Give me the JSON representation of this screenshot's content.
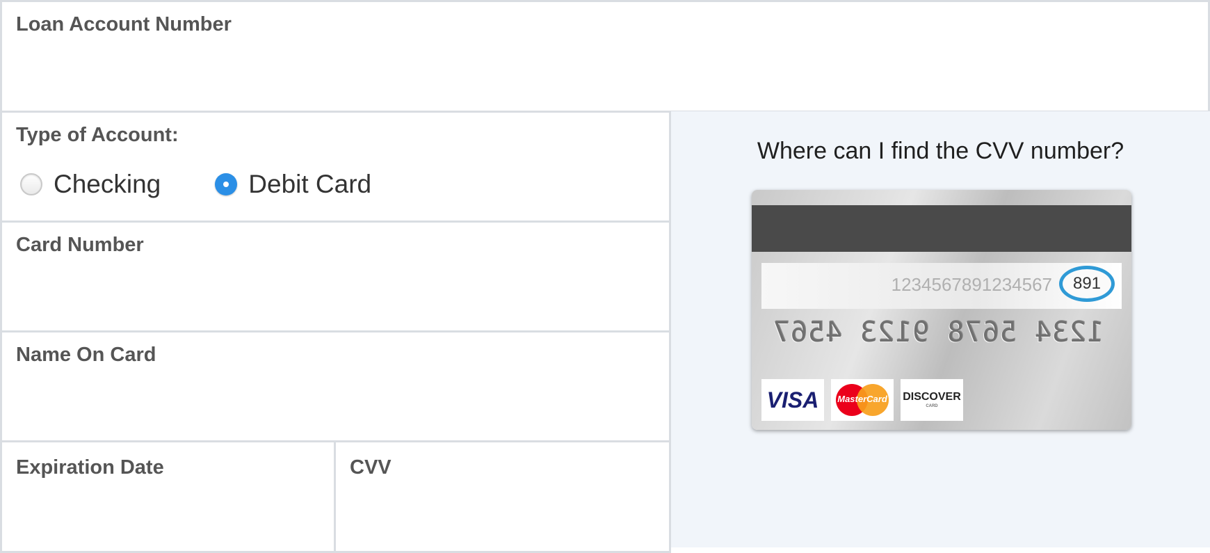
{
  "form": {
    "loan_account": {
      "label": "Loan Account Number",
      "value": ""
    },
    "account_type": {
      "label": "Type of Account:",
      "options": [
        {
          "label": "Checking",
          "selected": false
        },
        {
          "label": "Debit Card",
          "selected": true
        }
      ]
    },
    "card_number": {
      "label": "Card Number",
      "value": ""
    },
    "name_on_card": {
      "label": "Name On Card",
      "value": ""
    },
    "expiration_date": {
      "label": "Expiration Date",
      "value": ""
    },
    "cvv": {
      "label": "CVV",
      "value": ""
    }
  },
  "help": {
    "title": "Where can I find the CVV number?",
    "card": {
      "signature_number": "1234567891234567",
      "cvv_code": "891",
      "embossed_number": "1234 5678 9123 4567",
      "logos": [
        "VISA",
        "MasterCard",
        "DISCOVER"
      ],
      "discover_sub": "CARD"
    }
  },
  "colors": {
    "accent": "#2b8fe6",
    "border": "#d9dde2",
    "panel_bg": "#f1f5fa",
    "cvv_ring": "#2f9ad6"
  }
}
